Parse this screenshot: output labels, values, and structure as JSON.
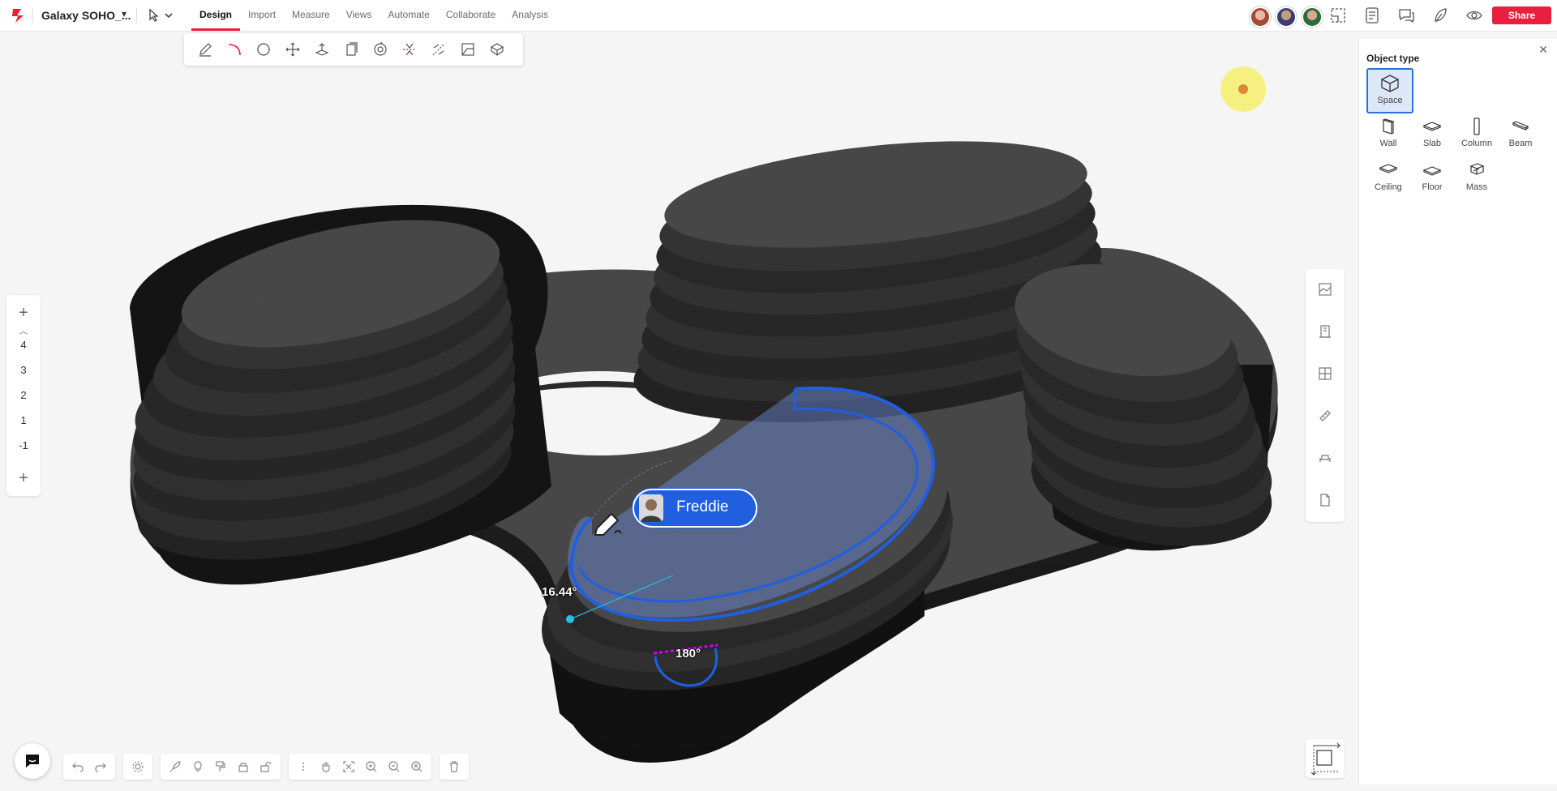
{
  "app": {
    "project_title": "Galaxy SOHO_...",
    "menu": [
      "Design",
      "Import",
      "Measure",
      "Views",
      "Automate",
      "Collaborate",
      "Analysis"
    ],
    "active_menu": "Design",
    "share_label": "Share",
    "brand_color": "#e8203e",
    "accent_color": "#2f6fde"
  },
  "toolbar": {
    "tools": [
      "pencil-icon",
      "arc-icon",
      "circle-icon",
      "move-icon",
      "extrude-icon",
      "copy-icon",
      "rotate-icon",
      "mirror-icon",
      "split-icon",
      "offset-icon",
      "solid-icon"
    ]
  },
  "levels": {
    "items": [
      "4",
      "3",
      "2",
      "1",
      "-1"
    ]
  },
  "right_panel": {
    "title": "Object type",
    "types": [
      {
        "label": "Space",
        "icon": "space-cube-icon",
        "selected": true
      },
      {
        "label": "Wall",
        "icon": "wall-icon"
      },
      {
        "label": "Slab",
        "icon": "slab-icon"
      },
      {
        "label": "Column",
        "icon": "column-icon"
      },
      {
        "label": "Beam",
        "icon": "beam-icon"
      },
      {
        "label": "Ceiling",
        "icon": "ceiling-icon"
      },
      {
        "label": "Floor",
        "icon": "floor-icon"
      },
      {
        "label": "Mass",
        "icon": "mass-icon"
      }
    ]
  },
  "viewport": {
    "collaborator_name": "Freddie",
    "angle_label": "16.44°",
    "arc_label": "180°"
  }
}
